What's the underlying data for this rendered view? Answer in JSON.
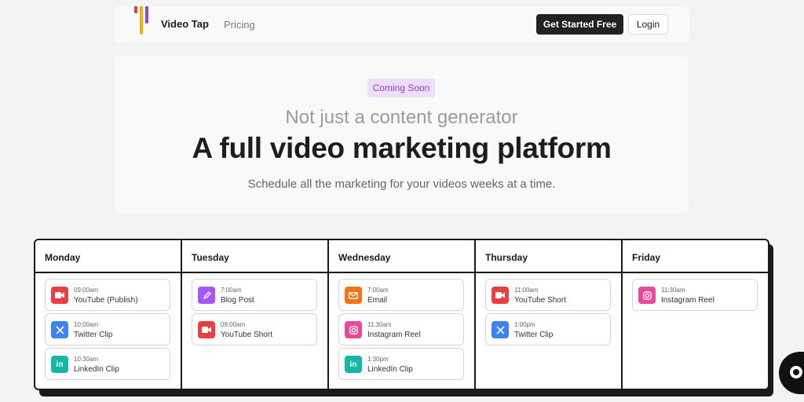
{
  "nav": {
    "brand": "Video Tap",
    "links": [
      "Pricing"
    ],
    "cta": "Get Started Free",
    "login": "Login"
  },
  "hero": {
    "badge": "Coming Soon",
    "subheadline": "Not just a content generator",
    "headline": "A full video marketing platform",
    "description": "Schedule all the marketing for your videos weeks at a time."
  },
  "calendar": {
    "days": [
      {
        "name": "Monday",
        "events": [
          {
            "time": "09:00am",
            "title": "YouTube (Publish)",
            "icon": "video-camera-icon",
            "color": "#e84040"
          },
          {
            "time": "10:00am",
            "title": "Twitter Clip",
            "icon": "x-twitter-icon",
            "color": "#3b82f6"
          },
          {
            "time": "10:30am",
            "title": "LinkedIn Clip",
            "icon": "linkedin-icon",
            "color": "#14b8a6"
          }
        ]
      },
      {
        "name": "Tuesday",
        "events": [
          {
            "time": "7:00am",
            "title": "Blog Post",
            "icon": "pen-icon",
            "color": "#a855f7"
          },
          {
            "time": "09:00am",
            "title": "YouTube Short",
            "icon": "video-camera-icon",
            "color": "#e84040"
          }
        ]
      },
      {
        "name": "Wednesday",
        "events": [
          {
            "time": "7:00am",
            "title": "Email",
            "icon": "mail-icon",
            "color": "#f97316"
          },
          {
            "time": "11:30am",
            "title": "Instagram Reel",
            "icon": "instagram-icon",
            "color": "#ec4899"
          },
          {
            "time": "1:30pm",
            "title": "LinkedIn Clip",
            "icon": "linkedin-icon",
            "color": "#14b8a6"
          }
        ]
      },
      {
        "name": "Thursday",
        "events": [
          {
            "time": "11:00am",
            "title": "YouTube Short",
            "icon": "video-camera-icon",
            "color": "#e84040"
          },
          {
            "time": "1:00pm",
            "title": "Twitter Clip",
            "icon": "x-twitter-icon",
            "color": "#3b82f6"
          }
        ]
      },
      {
        "name": "Friday",
        "events": [
          {
            "time": "11:30am",
            "title": "Instagram Reel",
            "icon": "instagram-icon",
            "color": "#ec4899"
          }
        ]
      }
    ]
  },
  "chat_widget": {
    "icon": "chat-bubble-icon"
  },
  "colors": {
    "accent_dark": "#222222",
    "badge_bg": "#eedff9",
    "badge_text": "#8a3fcf",
    "logo_red": "#e23b3b",
    "logo_yellow": "#f1b00f",
    "logo_purple": "#8a4bdc"
  }
}
